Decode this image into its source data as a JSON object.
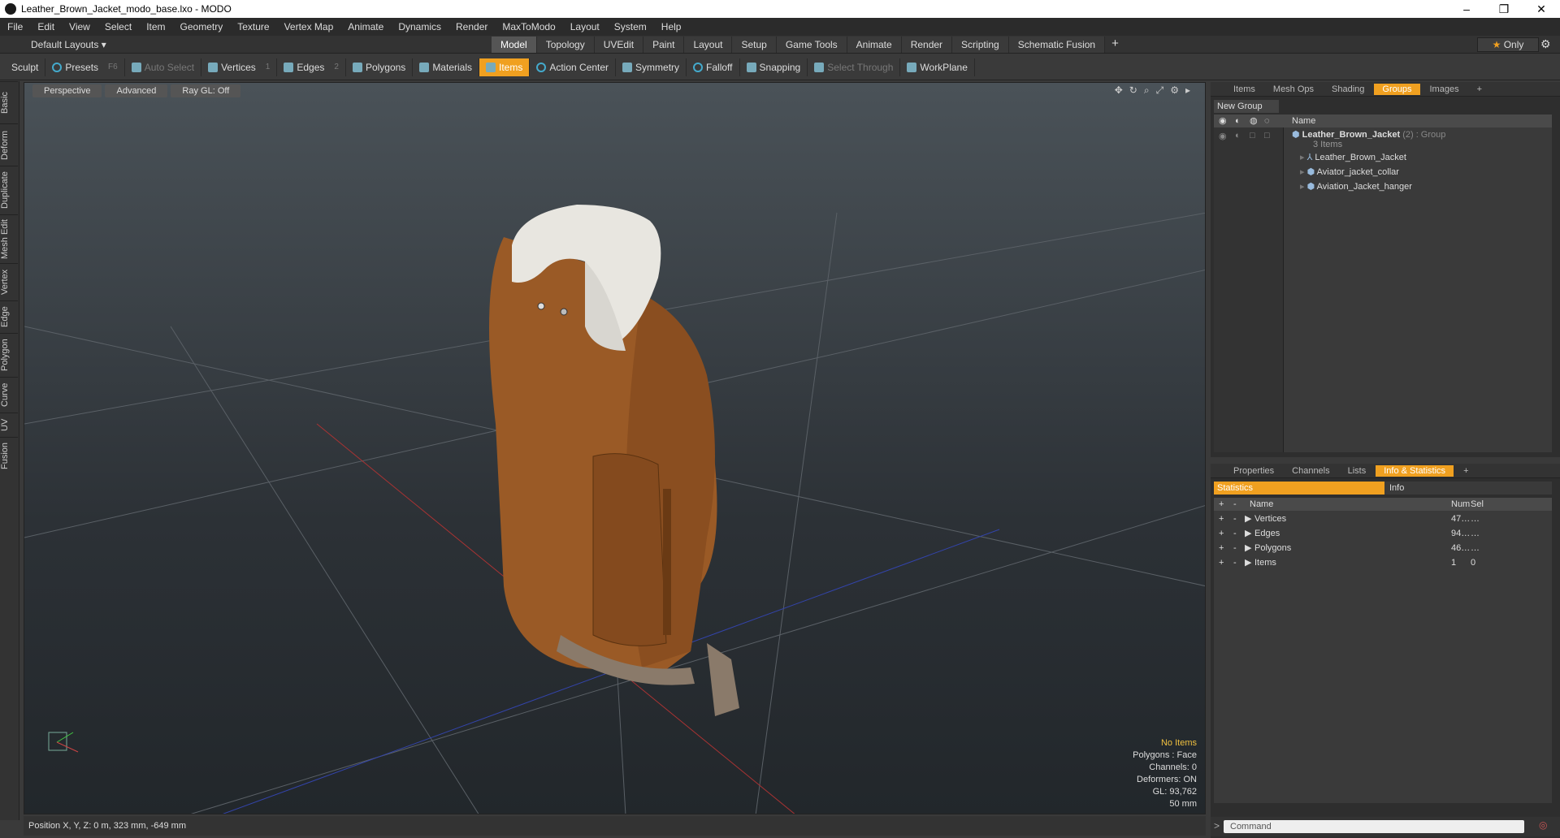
{
  "window": {
    "title": "Leather_Brown_Jacket_modo_base.lxo - MODO",
    "controls": [
      "–",
      "❐",
      "✕"
    ]
  },
  "menu": [
    "File",
    "Edit",
    "View",
    "Select",
    "Item",
    "Geometry",
    "Texture",
    "Vertex Map",
    "Animate",
    "Dynamics",
    "Render",
    "MaxToModo",
    "Layout",
    "System",
    "Help"
  ],
  "modebar": {
    "layouts": "Default Layouts ▾",
    "tabs": [
      "Model",
      "Topology",
      "UVEdit",
      "Paint",
      "Layout",
      "Setup",
      "Game Tools",
      "Animate",
      "Render",
      "Scripting",
      "Schematic Fusion"
    ],
    "active_tab": "Model",
    "plus": "+",
    "only": "Only",
    "star": "★"
  },
  "toolbar": {
    "sculpt": "Sculpt",
    "presets": "Presets",
    "presets_key": "F6",
    "auto_select": "Auto Select",
    "vertices": "Vertices",
    "vertices_key": "1",
    "edges": "Edges",
    "edges_key": "2",
    "polygons": "Polygons",
    "materials": "Materials",
    "items": "Items",
    "action_center": "Action Center",
    "symmetry": "Symmetry",
    "falloff": "Falloff",
    "snapping": "Snapping",
    "select_through": "Select Through",
    "workplane": "WorkPlane"
  },
  "left_tabs": [
    "Basic",
    "Deform",
    "Duplicate",
    "Mesh Edit",
    "Vertex",
    "Edge",
    "Polygon",
    "Curve",
    "UV",
    "Fusion"
  ],
  "viewport": {
    "view": "Perspective",
    "shading": "Advanced",
    "raygl": "Ray GL: Off",
    "info": {
      "no_items": "No Items",
      "polygons": "Polygons : Face",
      "channels": "Channels: 0",
      "deformers": "Deformers: ON",
      "gl": "GL: 93,762",
      "scale": "50 mm"
    }
  },
  "status": "Position X, Y, Z:  0 m, 323 mm, -649 mm",
  "groups_panel": {
    "tabs": [
      "Items",
      "Mesh Ops",
      "Shading",
      "Groups",
      "Images"
    ],
    "active": "Groups",
    "plus": "+",
    "new_group": "New Group",
    "name_header": "Name",
    "group_name": "Leather_Brown_Jacket",
    "group_suffix": "(2) : Group",
    "group_count": "3 Items",
    "children": [
      "Leather_Brown_Jacket",
      "Aviator_jacket_collar",
      "Aviation_Jacket_hanger"
    ]
  },
  "info_panel": {
    "tabs": [
      "Properties",
      "Channels",
      "Lists",
      "Info & Statistics"
    ],
    "active": "Info & Statistics",
    "plus": "+",
    "statistics": "Statistics",
    "info": "Info",
    "headers": {
      "name": "Name",
      "num": "Num",
      "sel": "Sel"
    },
    "rows": [
      {
        "name": "Vertices",
        "num": "47…",
        "sel": "…"
      },
      {
        "name": "Edges",
        "num": "94…",
        "sel": "…"
      },
      {
        "name": "Polygons",
        "num": "46…",
        "sel": "…"
      },
      {
        "name": "Items",
        "num": "1",
        "sel": "0"
      }
    ]
  },
  "command": {
    "placeholder": "Command"
  },
  "colors": {
    "accent": "#f0a020",
    "jacket": "#9a5a26",
    "collar": "#e8e6e0"
  }
}
